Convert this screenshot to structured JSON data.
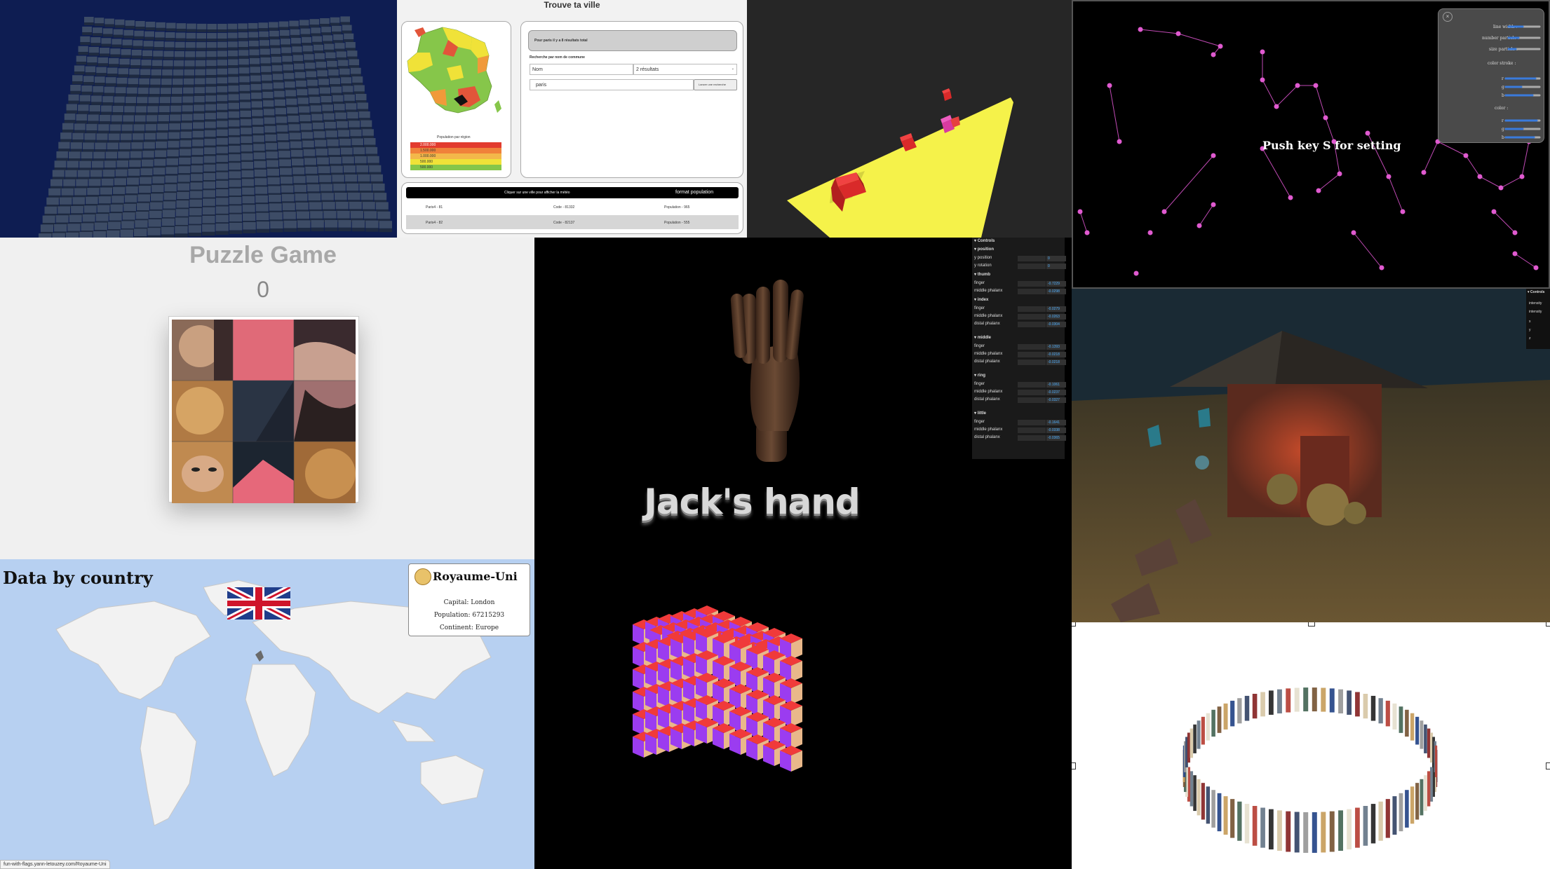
{
  "ville": {
    "title": "Trouve ta ville",
    "legend_title": "Population par région",
    "legend_items": [
      "2.000.000",
      "1.500.000",
      "1.000.000",
      "500.000",
      "500.000"
    ],
    "result_banner": "Pour paris il y a 8 résultats total",
    "search_label": "Recherche par nom de commune",
    "select_field": "Nom",
    "select_results": "2 résultats",
    "search_value": "paris",
    "search_button": "Lancer une recherche",
    "table_hint": "Cliquer sur une ville pour afficher la météo",
    "table_header": "format population",
    "rows": [
      {
        "city": "Paris4 - 81",
        "code": "Code - 81332",
        "population": "Population - 965"
      },
      {
        "city": "Paris4 - 82",
        "code": "Code - 82137",
        "population": "Population - 555"
      }
    ]
  },
  "stars": {
    "message": "Push key S for setting",
    "settings": {
      "line_width": "line width :",
      "number_particle": "number particle :",
      "size_particle": "size particle :",
      "color_stroke": "color stroke :",
      "color": "color :",
      "r": "r",
      "g": "g",
      "b": "b"
    },
    "colors": {
      "particle": "#e05ad0",
      "line": "#c04ab4"
    }
  },
  "puzzle": {
    "title": "Puzzle Game",
    "score": "0"
  },
  "hand": {
    "title": "Jack's hand",
    "gui": {
      "header": "Controls",
      "groups": [
        {
          "name": "position",
          "rows": [
            {
              "label": "y position",
              "value": "0"
            },
            {
              "label": "y rotation",
              "value": "0"
            }
          ]
        },
        {
          "name": "thumb",
          "rows": [
            {
              "label": "finger",
              "value": "-0.7229"
            },
            {
              "label": "middle phalanx",
              "value": "-0.0298"
            }
          ]
        },
        {
          "name": "index",
          "rows": [
            {
              "label": "finger",
              "value": "-0.0279"
            },
            {
              "label": "middle phalanx",
              "value": "-0.0263"
            },
            {
              "label": "distal phalanx",
              "value": "-0.0304"
            }
          ]
        },
        {
          "name": "middle",
          "rows": [
            {
              "label": "finger",
              "value": "-0.1393"
            },
            {
              "label": "middle phalanx",
              "value": "-0.0218"
            },
            {
              "label": "distal phalanx",
              "value": "-0.0218"
            }
          ]
        },
        {
          "name": "ring",
          "rows": [
            {
              "label": "finger",
              "value": "-0.1061"
            },
            {
              "label": "middle phalanx",
              "value": "-0.0237"
            },
            {
              "label": "distal phalanx",
              "value": "-0.0327"
            }
          ]
        },
        {
          "name": "little",
          "rows": [
            {
              "label": "finger",
              "value": "-0.1641"
            },
            {
              "label": "middle phalanx",
              "value": "-0.0338"
            },
            {
              "label": "distal phalanx",
              "value": "-0.0365"
            }
          ]
        }
      ]
    }
  },
  "house": {
    "controls": {
      "header": "Controls",
      "items": [
        "intensity",
        "intensity",
        "x",
        "y",
        "z"
      ]
    }
  },
  "country": {
    "heading": "Data by country",
    "name": "Royaume-Uni",
    "capital": "Capital: London",
    "population": "Population: 67215293",
    "continent": "Continent: Europe",
    "url": "fun-with-flags.yann-letouzey.com/Royaume-Uni"
  }
}
